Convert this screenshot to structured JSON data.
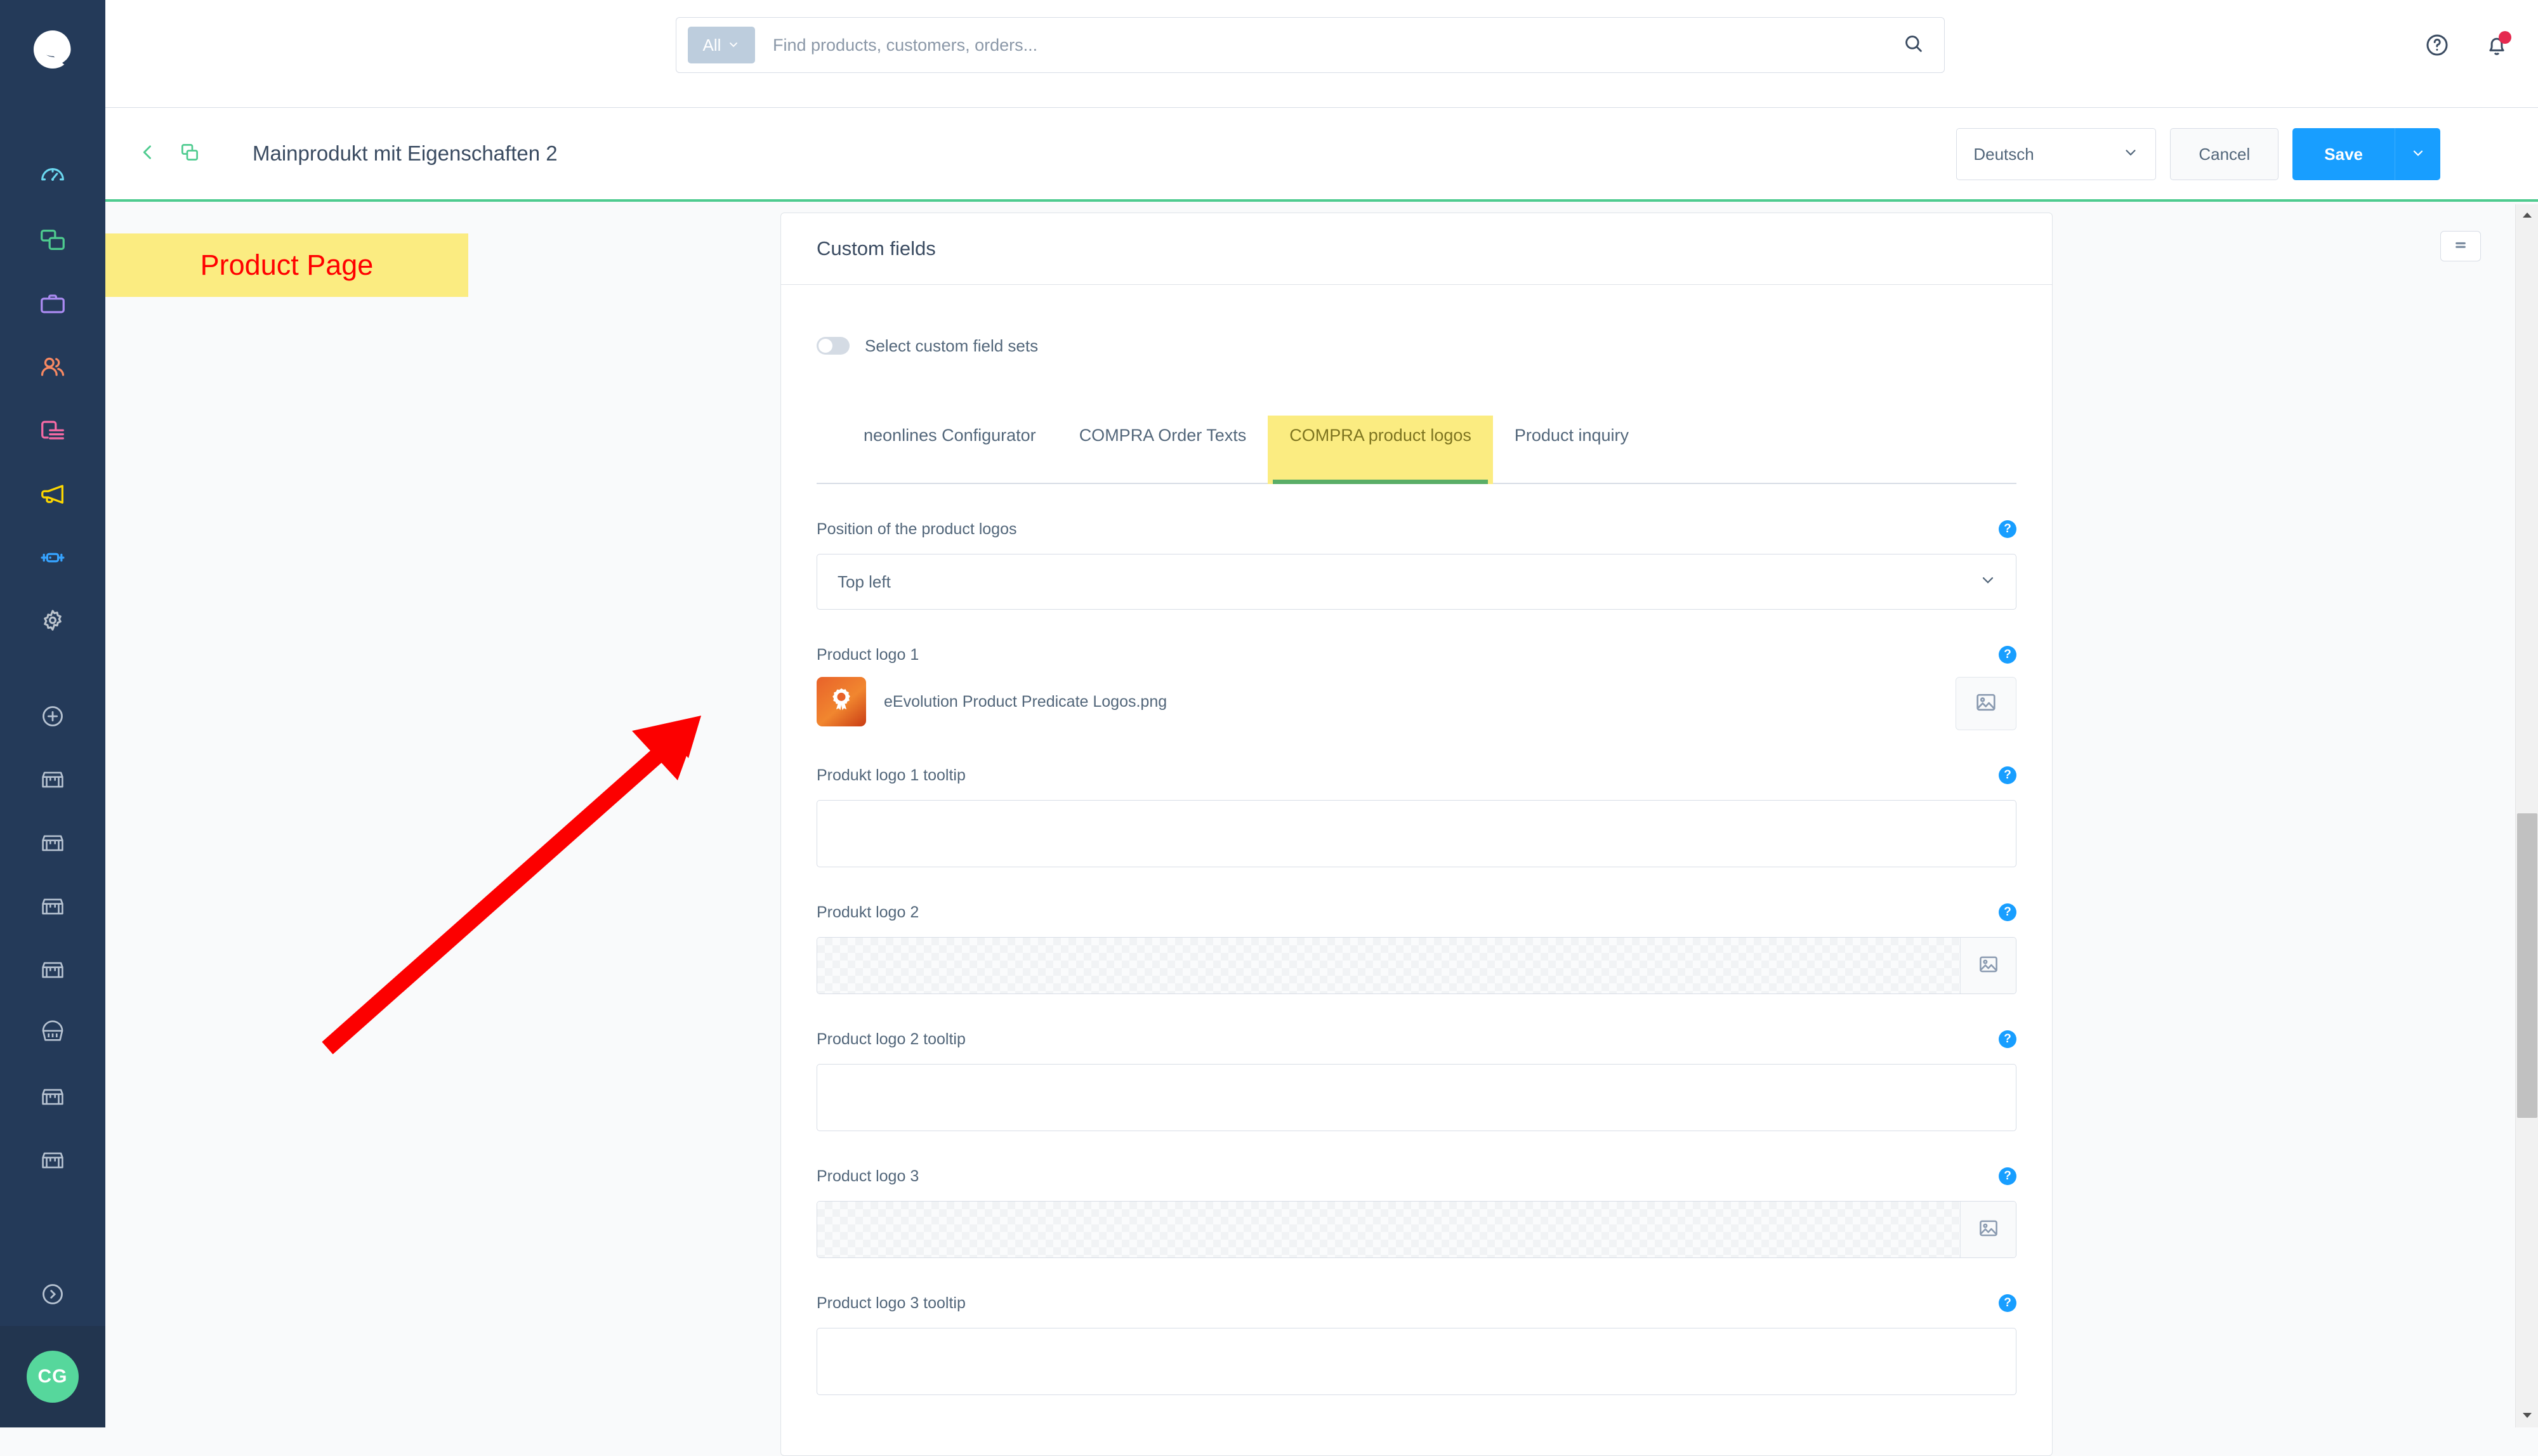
{
  "app": {
    "brand": "shopware-logo",
    "accent_blue": "#189eff",
    "accent_green": "#4ecb8f",
    "sidebar_bg": "#243a59",
    "annotation_yellow": "#fbec81",
    "annotation_red": "#ff0000"
  },
  "sidebar": {
    "items": [
      {
        "name": "dashboard",
        "icon": "gauge-icon",
        "color": "#6bd8f0"
      },
      {
        "name": "catalogues",
        "icon": "copy-icon",
        "color": "#4ecb8f"
      },
      {
        "name": "orders",
        "icon": "briefcase-icon",
        "color": "#ab8bf2"
      },
      {
        "name": "customers",
        "icon": "users-icon",
        "color": "#f88962"
      },
      {
        "name": "content",
        "icon": "content-icon",
        "color": "#f56aa4"
      },
      {
        "name": "marketing",
        "icon": "megaphone-icon",
        "color": "#fdd700"
      },
      {
        "name": "extensions",
        "icon": "plug-icon",
        "color": "#36a3ff"
      },
      {
        "name": "settings",
        "icon": "gear-icon",
        "color": "#bcc4cd"
      }
    ],
    "shop_items": [
      {
        "name": "add-sales-channel",
        "icon": "plus-circle-icon"
      },
      {
        "name": "sales-channel-1",
        "icon": "storefront-icon"
      },
      {
        "name": "sales-channel-2",
        "icon": "storefront-icon"
      },
      {
        "name": "sales-channel-3",
        "icon": "storefront-icon"
      },
      {
        "name": "sales-channel-4",
        "icon": "storefront-icon"
      },
      {
        "name": "sales-channel-5",
        "icon": "basket-icon"
      },
      {
        "name": "sales-channel-6",
        "icon": "storefront-icon"
      },
      {
        "name": "sales-channel-7",
        "icon": "storefront-icon"
      }
    ],
    "expand": {
      "name": "expand-sidebar",
      "icon": "chevron-right-circle-icon"
    },
    "avatar_initials": "CG"
  },
  "search": {
    "scope_label": "All",
    "placeholder": "Find products, customers, orders...",
    "value": "",
    "icon": "search-icon"
  },
  "topbar_actions": [
    {
      "name": "help-button",
      "icon": "question-circle-icon"
    },
    {
      "name": "notifications-button",
      "icon": "bell-icon",
      "has_badge": true,
      "badge_color": "#e5294f"
    }
  ],
  "header": {
    "back_icon": "chevron-left-icon",
    "duplicate_icon": "copy-icon",
    "title": "Mainprodukt mit Eigenschaften 2",
    "language": "Deutsch",
    "cancel_label": "Cancel",
    "save_label": "Save",
    "save_caret_icon": "chevron-down-icon"
  },
  "annotation": {
    "label": "Product Page",
    "arrow": "red-arrow-pointing-up-right"
  },
  "content": {
    "collapse_button_icon": "hamburger-icon"
  },
  "card": {
    "title": "Custom fields",
    "toggle": {
      "label": "Select custom field sets",
      "state": "off"
    },
    "tabs": [
      {
        "label": "neonlines Configurator",
        "active": false,
        "highlighted": false
      },
      {
        "label": "COMPRA Order Texts",
        "active": false,
        "highlighted": false
      },
      {
        "label": "COMPRA product logos",
        "active": true,
        "highlighted": true
      },
      {
        "label": "Product inquiry",
        "active": false,
        "highlighted": false
      }
    ],
    "fields": [
      {
        "name": "position-of-the-product-logos",
        "label": "Position of the product logos",
        "type": "select",
        "value": "Top left",
        "help": "?"
      },
      {
        "name": "product-logo-1",
        "label": "Product logo 1",
        "type": "media-filled",
        "file_name": "eEvolution Product Predicate Logos.png",
        "thumb_icon": "award-badge-icon",
        "upload_icon": "image-icon",
        "help": "?"
      },
      {
        "name": "produkt-logo-1-tooltip",
        "label": "Produkt logo 1 tooltip",
        "type": "text",
        "value": "",
        "placeholder": "",
        "help": "?"
      },
      {
        "name": "produkt-logo-2",
        "label": "Produkt logo 2",
        "type": "media-empty",
        "upload_icon": "image-icon",
        "help": "?"
      },
      {
        "name": "product-logo-2-tooltip",
        "label": "Product logo 2 tooltip",
        "type": "text",
        "value": "",
        "placeholder": "",
        "help": "?"
      },
      {
        "name": "product-logo-3",
        "label": "Product logo 3",
        "type": "media-empty",
        "upload_icon": "image-icon",
        "help": "?"
      },
      {
        "name": "product-logo-3-tooltip",
        "label": "Product logo 3 tooltip",
        "type": "text",
        "value": "",
        "placeholder": "",
        "help": "?"
      }
    ]
  },
  "scrollbar": {
    "up_icon": "triangle-up-icon",
    "down_icon": "triangle-down-icon"
  }
}
